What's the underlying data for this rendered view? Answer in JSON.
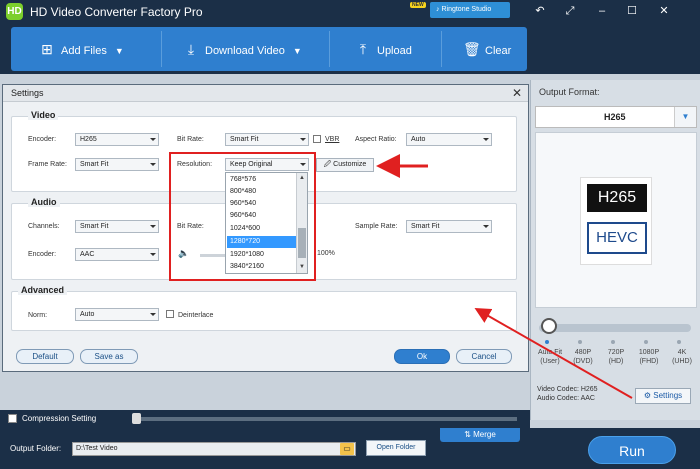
{
  "app": {
    "title": "HD Video Converter Factory Pro",
    "logo_letters": "HD",
    "new_badge": "NEW",
    "ringtone_studio": "Ringtone Studio"
  },
  "toolbar": {
    "add_files": "Add Files",
    "download_video": "Download Video",
    "upload": "Upload",
    "clear": "Clear"
  },
  "dialog": {
    "title": "Settings",
    "video": {
      "heading": "Video",
      "encoder_label": "Encoder:",
      "encoder_value": "H265",
      "bitrate_label": "Bit Rate:",
      "bitrate_value": "Smart Fit",
      "vbr_label": "VBR",
      "aspect_label": "Aspect Ratio:",
      "aspect_value": "Auto",
      "framerate_label": "Frame Rate:",
      "framerate_value": "Smart Fit",
      "resolution_label": "Resolution:",
      "resolution_value": "Keep Original",
      "customize_label": "Customize",
      "resolution_options": [
        "768*576",
        "800*480",
        "960*540",
        "960*640",
        "1024*600",
        "1280*720",
        "1920*1080",
        "3840*2160"
      ],
      "resolution_selected_index": 5
    },
    "audio": {
      "heading": "Audio",
      "channels_label": "Channels:",
      "channels_value": "Smart Fit",
      "bitrate_label": "Bit Rate:",
      "samplerate_label": "Sample Rate:",
      "samplerate_value": "Smart Fit",
      "encoder_label": "Encoder:",
      "encoder_value": "AAC",
      "volume_pct": "100%"
    },
    "advanced": {
      "heading": "Advanced",
      "norm_label": "Norm:",
      "norm_value": "Auto",
      "deinterlace_label": "Deinterlace"
    },
    "buttons": {
      "default": "Default",
      "save_as": "Save as",
      "ok": "Ok",
      "cancel": "Cancel"
    }
  },
  "right_panel": {
    "output_format_label": "Output Format:",
    "format_value": "H265",
    "codec_top": "H265",
    "codec_bottom": "HEVC",
    "resolution_stops": [
      {
        "line1": "Auto Fit",
        "line2": "(User)"
      },
      {
        "line1": "480P",
        "line2": "(DVD)"
      },
      {
        "line1": "720P",
        "line2": "(HD)"
      },
      {
        "line1": "1080P",
        "line2": "(FHD)"
      },
      {
        "line1": "4K",
        "line2": "(UHD)"
      }
    ],
    "video_codec": "Video Codec: H265",
    "audio_codec": "Audio Codec: AAC",
    "settings_button": "Settings"
  },
  "bottom": {
    "compression_label": "Compression Setting",
    "merge_label": "Merge",
    "output_folder_label": "Output Folder:",
    "output_folder_value": "D:\\Test Video",
    "open_folder": "Open Folder",
    "run": "Run"
  },
  "colors": {
    "accent": "#2f7fcf",
    "titlebar": "#1b2f47",
    "highlight": "#e02020"
  }
}
